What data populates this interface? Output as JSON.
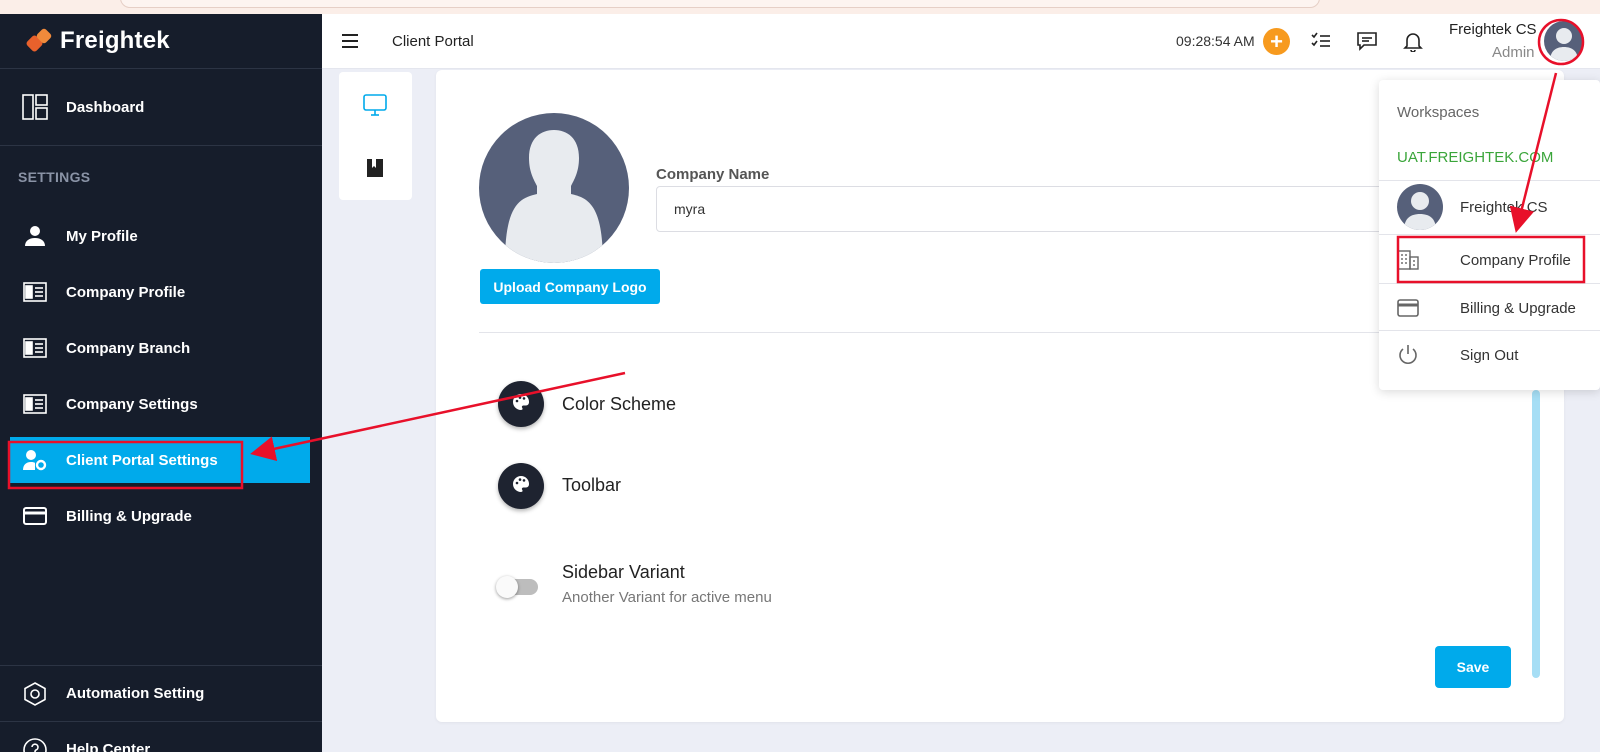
{
  "app": {
    "brand": "Freightek"
  },
  "sidebar": {
    "dashboard_label": "Dashboard",
    "section_label": "SETTINGS",
    "items": [
      {
        "label": "My Profile",
        "icon": "user-icon"
      },
      {
        "label": "Company Profile",
        "icon": "id-card-icon"
      },
      {
        "label": "Company Branch",
        "icon": "id-card-icon"
      },
      {
        "label": "Company Settings",
        "icon": "id-card-icon"
      },
      {
        "label": "Client Portal Settings",
        "icon": "user-gear-icon",
        "active": true
      },
      {
        "label": "Billing & Upgrade",
        "icon": "credit-card-icon"
      }
    ],
    "bottom_items": [
      {
        "label": "Automation Setting",
        "icon": "hexagon-gear-icon"
      },
      {
        "label": "Help Center",
        "icon": "help-icon"
      }
    ]
  },
  "header": {
    "title": "Client Portal",
    "clock": "09:28:54 AM",
    "user_name": "Freightek CS",
    "user_role": "Admin"
  },
  "main": {
    "company_name_label": "Company Name",
    "company_name_value": "myra",
    "upload_label": "Upload Company Logo",
    "options": [
      {
        "label": "Color Scheme",
        "icon": "palette-icon"
      },
      {
        "label": "Toolbar",
        "icon": "palette-icon"
      }
    ],
    "sidebar_variant": {
      "label": "Sidebar Variant",
      "description": "Another Variant for active menu",
      "enabled": false
    },
    "save_label": "Save"
  },
  "dropdown": {
    "section": "Workspaces",
    "workspace": "UAT.FREIGHTEK.COM",
    "user": "Freightek CS",
    "items": [
      {
        "label": "Company Profile",
        "icon": "building-icon"
      },
      {
        "label": "Billing & Upgrade",
        "icon": "credit-card-icon"
      },
      {
        "label": "Sign Out",
        "icon": "power-icon"
      }
    ]
  },
  "colors": {
    "sidebar_bg": "#161d2b",
    "accent": "#00aaeb",
    "plus_button": "#f79a1e",
    "workspace_text": "#3aa53a",
    "annotation": "#e8102a"
  }
}
